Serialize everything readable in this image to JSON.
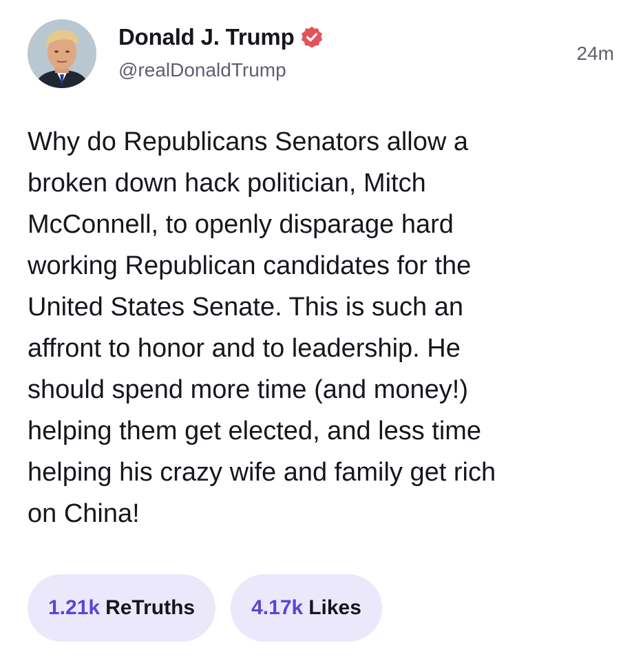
{
  "post": {
    "author": {
      "display_name": "Donald J. Trump",
      "handle": "@realDonaldTrump",
      "verified_icon": "verified-badge-icon",
      "verified_color": "#e2545a"
    },
    "timestamp": "24m",
    "body": "Why do Republicans Senators allow a\nbroken down hack politician, Mitch\nMcConnell, to openly disparage hard\nworking Republican candidates for the\nUnited States Senate. This is such an\naffront to honor and to leadership. He\nshould spend more time (and money!)\nhelping them get elected, and less time\nhelping his crazy wife and family get rich\non China!",
    "actions": {
      "retruths": {
        "count": "1.21k",
        "label": "ReTruths"
      },
      "likes": {
        "count": "4.17k",
        "label": "Likes"
      }
    }
  },
  "colors": {
    "accent": "#5b44d6",
    "pill_background": "#ebe8fb",
    "text": "#16161d",
    "muted": "#5e5e6e"
  }
}
